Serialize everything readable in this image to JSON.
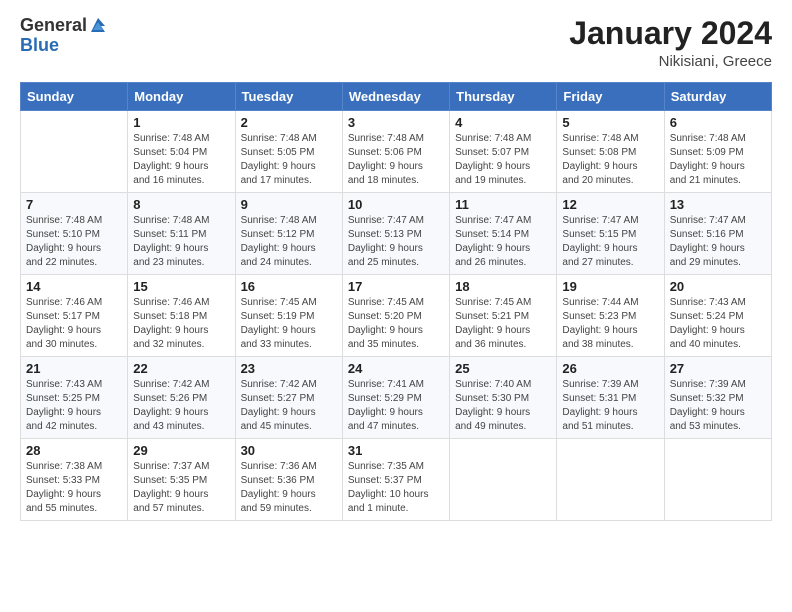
{
  "header": {
    "logo_general": "General",
    "logo_blue": "Blue",
    "month_title": "January 2024",
    "location": "Nikisiani, Greece"
  },
  "weekdays": [
    "Sunday",
    "Monday",
    "Tuesday",
    "Wednesday",
    "Thursday",
    "Friday",
    "Saturday"
  ],
  "weeks": [
    [
      {
        "day": "",
        "info": ""
      },
      {
        "day": "1",
        "info": "Sunrise: 7:48 AM\nSunset: 5:04 PM\nDaylight: 9 hours\nand 16 minutes."
      },
      {
        "day": "2",
        "info": "Sunrise: 7:48 AM\nSunset: 5:05 PM\nDaylight: 9 hours\nand 17 minutes."
      },
      {
        "day": "3",
        "info": "Sunrise: 7:48 AM\nSunset: 5:06 PM\nDaylight: 9 hours\nand 18 minutes."
      },
      {
        "day": "4",
        "info": "Sunrise: 7:48 AM\nSunset: 5:07 PM\nDaylight: 9 hours\nand 19 minutes."
      },
      {
        "day": "5",
        "info": "Sunrise: 7:48 AM\nSunset: 5:08 PM\nDaylight: 9 hours\nand 20 minutes."
      },
      {
        "day": "6",
        "info": "Sunrise: 7:48 AM\nSunset: 5:09 PM\nDaylight: 9 hours\nand 21 minutes."
      }
    ],
    [
      {
        "day": "7",
        "info": "Sunrise: 7:48 AM\nSunset: 5:10 PM\nDaylight: 9 hours\nand 22 minutes."
      },
      {
        "day": "8",
        "info": "Sunrise: 7:48 AM\nSunset: 5:11 PM\nDaylight: 9 hours\nand 23 minutes."
      },
      {
        "day": "9",
        "info": "Sunrise: 7:48 AM\nSunset: 5:12 PM\nDaylight: 9 hours\nand 24 minutes."
      },
      {
        "day": "10",
        "info": "Sunrise: 7:47 AM\nSunset: 5:13 PM\nDaylight: 9 hours\nand 25 minutes."
      },
      {
        "day": "11",
        "info": "Sunrise: 7:47 AM\nSunset: 5:14 PM\nDaylight: 9 hours\nand 26 minutes."
      },
      {
        "day": "12",
        "info": "Sunrise: 7:47 AM\nSunset: 5:15 PM\nDaylight: 9 hours\nand 27 minutes."
      },
      {
        "day": "13",
        "info": "Sunrise: 7:47 AM\nSunset: 5:16 PM\nDaylight: 9 hours\nand 29 minutes."
      }
    ],
    [
      {
        "day": "14",
        "info": "Sunrise: 7:46 AM\nSunset: 5:17 PM\nDaylight: 9 hours\nand 30 minutes."
      },
      {
        "day": "15",
        "info": "Sunrise: 7:46 AM\nSunset: 5:18 PM\nDaylight: 9 hours\nand 32 minutes."
      },
      {
        "day": "16",
        "info": "Sunrise: 7:45 AM\nSunset: 5:19 PM\nDaylight: 9 hours\nand 33 minutes."
      },
      {
        "day": "17",
        "info": "Sunrise: 7:45 AM\nSunset: 5:20 PM\nDaylight: 9 hours\nand 35 minutes."
      },
      {
        "day": "18",
        "info": "Sunrise: 7:45 AM\nSunset: 5:21 PM\nDaylight: 9 hours\nand 36 minutes."
      },
      {
        "day": "19",
        "info": "Sunrise: 7:44 AM\nSunset: 5:23 PM\nDaylight: 9 hours\nand 38 minutes."
      },
      {
        "day": "20",
        "info": "Sunrise: 7:43 AM\nSunset: 5:24 PM\nDaylight: 9 hours\nand 40 minutes."
      }
    ],
    [
      {
        "day": "21",
        "info": "Sunrise: 7:43 AM\nSunset: 5:25 PM\nDaylight: 9 hours\nand 42 minutes."
      },
      {
        "day": "22",
        "info": "Sunrise: 7:42 AM\nSunset: 5:26 PM\nDaylight: 9 hours\nand 43 minutes."
      },
      {
        "day": "23",
        "info": "Sunrise: 7:42 AM\nSunset: 5:27 PM\nDaylight: 9 hours\nand 45 minutes."
      },
      {
        "day": "24",
        "info": "Sunrise: 7:41 AM\nSunset: 5:29 PM\nDaylight: 9 hours\nand 47 minutes."
      },
      {
        "day": "25",
        "info": "Sunrise: 7:40 AM\nSunset: 5:30 PM\nDaylight: 9 hours\nand 49 minutes."
      },
      {
        "day": "26",
        "info": "Sunrise: 7:39 AM\nSunset: 5:31 PM\nDaylight: 9 hours\nand 51 minutes."
      },
      {
        "day": "27",
        "info": "Sunrise: 7:39 AM\nSunset: 5:32 PM\nDaylight: 9 hours\nand 53 minutes."
      }
    ],
    [
      {
        "day": "28",
        "info": "Sunrise: 7:38 AM\nSunset: 5:33 PM\nDaylight: 9 hours\nand 55 minutes."
      },
      {
        "day": "29",
        "info": "Sunrise: 7:37 AM\nSunset: 5:35 PM\nDaylight: 9 hours\nand 57 minutes."
      },
      {
        "day": "30",
        "info": "Sunrise: 7:36 AM\nSunset: 5:36 PM\nDaylight: 9 hours\nand 59 minutes."
      },
      {
        "day": "31",
        "info": "Sunrise: 7:35 AM\nSunset: 5:37 PM\nDaylight: 10 hours\nand 1 minute."
      },
      {
        "day": "",
        "info": ""
      },
      {
        "day": "",
        "info": ""
      },
      {
        "day": "",
        "info": ""
      }
    ]
  ]
}
